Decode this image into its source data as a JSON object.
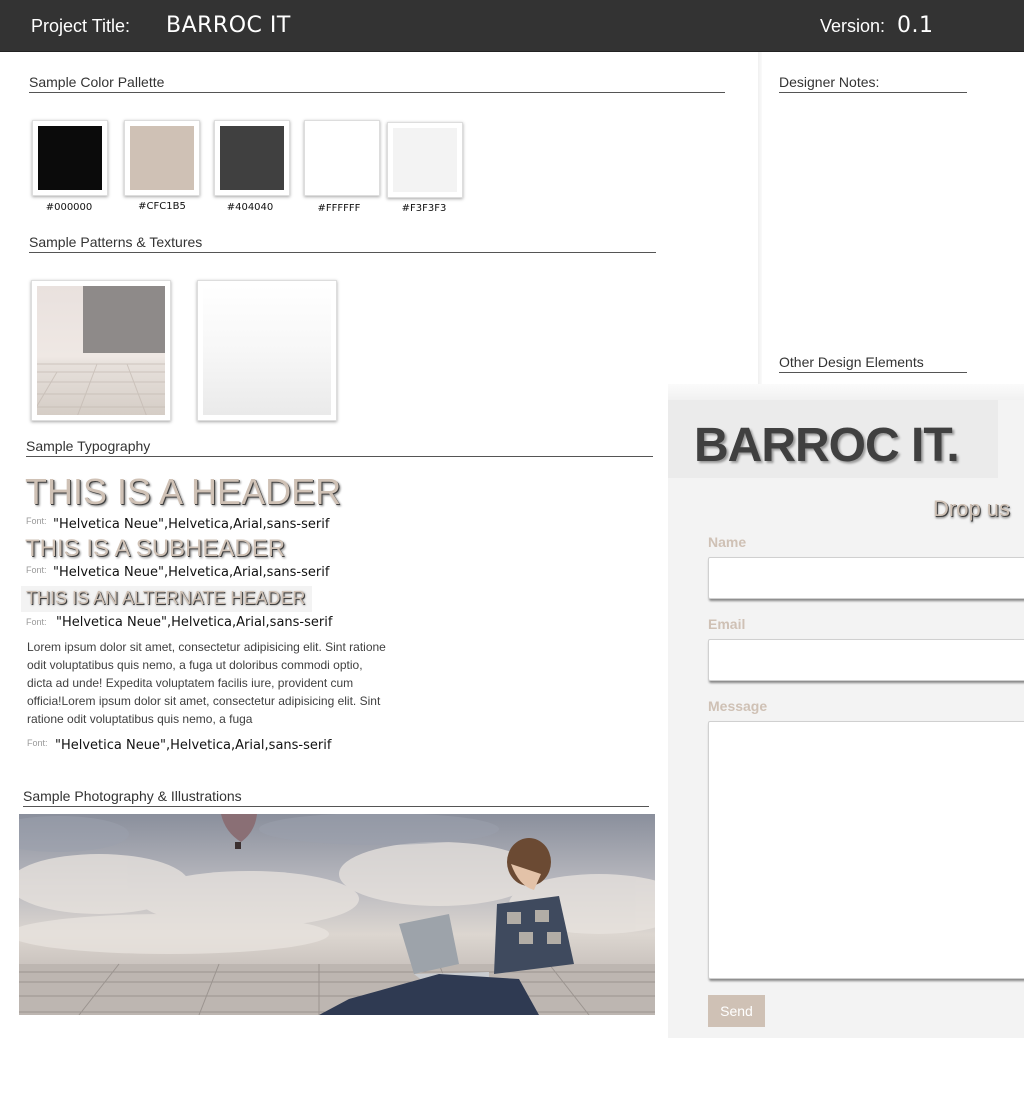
{
  "header": {
    "project_title_label": "Project Title:",
    "project_title": "BARROC IT",
    "version_label": "Version:",
    "version": "0.1"
  },
  "palette": {
    "title": "Sample Color Pallette",
    "swatches": [
      {
        "color": "#0b0b0b",
        "code": "#000000"
      },
      {
        "color": "#cfc1b5",
        "code": "#CFC1B5"
      },
      {
        "color": "#404040",
        "code": "#404040"
      },
      {
        "color": "#ffffff",
        "code": "#FFFFFF"
      },
      {
        "color": "#f3f3f3",
        "code": "#F3F3F3"
      }
    ]
  },
  "patterns": {
    "title": "Sample Patterns & Textures"
  },
  "typography": {
    "title": "Sample Typography",
    "header": "THIS IS A HEADER",
    "subheader": "THIS IS A SUBHEADER",
    "alternate_header": "THIS IS AN ALTERNATE HEADER",
    "font_tag": "Font:",
    "font_stack": "\"Helvetica Neue\",Helvetica,Arial,sans-serif",
    "body": "Lorem ipsum dolor sit amet, consectetur adipisicing elit. Sint ratione odit voluptatibus quis nemo, a fuga ut doloribus commodi optio, dicta ad unde! Expedita voluptatem facilis iure, provident cum officia!Lorem ipsum dolor sit amet, consectetur adipisicing elit. Sint ratione odit voluptatibus quis nemo, a fuga"
  },
  "photography": {
    "title": "Sample Photography & Illustrations"
  },
  "sidebar": {
    "designer_notes_title": "Designer Notes:",
    "other_elements_title": "Other Design Elements"
  },
  "contact": {
    "brand": "BARROC IT.",
    "heading": "Drop us",
    "name_label": "Name",
    "email_label": "Email",
    "message_label": "Message",
    "send_label": "Send"
  }
}
